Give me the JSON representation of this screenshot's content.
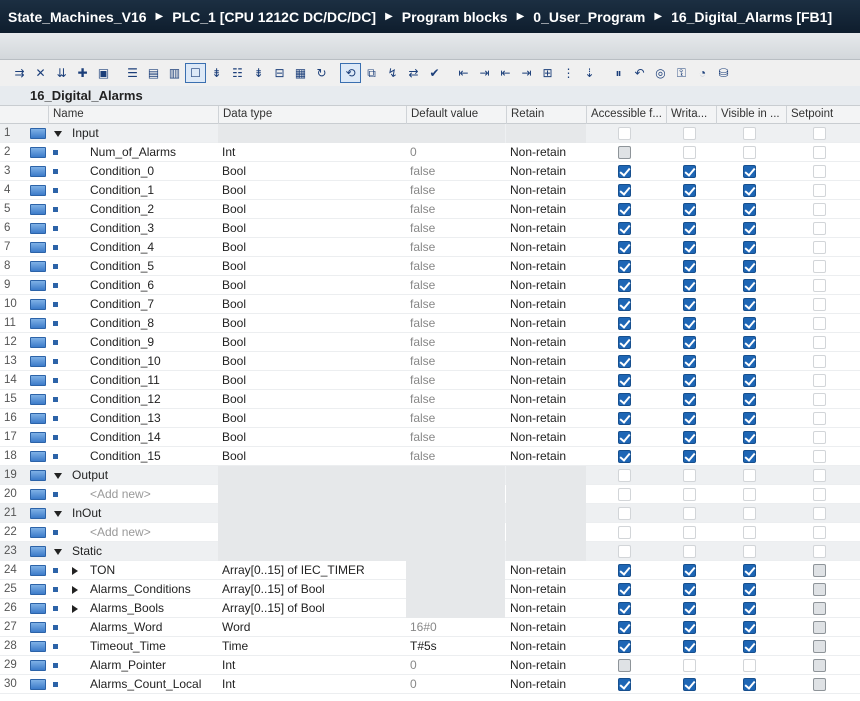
{
  "breadcrumb": [
    "State_Machines_V16",
    "PLC_1 [CPU 1212C DC/DC/DC]",
    "Program blocks",
    "0_User_Program",
    "16_Digital_Alarms [FB1]"
  ],
  "block_title": "16_Digital_Alarms",
  "columns": {
    "name": "Name",
    "data_type": "Data type",
    "default_value": "Default value",
    "retain": "Retain",
    "accessible": "Accessible f...",
    "writable": "Writa...",
    "visible": "Visible in ...",
    "setpoint": "Setpoint"
  },
  "toolbar_icons": [
    "insert-row-icon",
    "delete-row-icon",
    "insert-row-below-icon",
    "add-row-icon",
    "snapshot-icon",
    "expand-all-icon",
    "collapse-all-icon",
    "details-icon",
    "comment-icon",
    "monitor-icon",
    "load-start-icon",
    "update-icon",
    "list-icon",
    "display-icon",
    "settings-icon",
    "reset-icon",
    "copy-icon",
    "snapshot-load-icon",
    "compare-icon",
    "download-icon",
    "nav-left-icon",
    "nav-right-icon",
    "indent-icon",
    "outdent-icon",
    "grid-icon",
    "format-icon",
    "sort-icon",
    "pause-icon",
    "undo-icon",
    "watch-icon",
    "key-icon",
    "glasses-icon",
    "database-icon"
  ],
  "rows": [
    {
      "num": "1",
      "kind": "section",
      "expand": "down",
      "name": "Input",
      "type": "",
      "def": "",
      "ret": "",
      "acc": "dim",
      "wr": "dim",
      "vis": "dim",
      "set": "dim"
    },
    {
      "num": "2",
      "kind": "var",
      "name": "Num_of_Alarms",
      "type": "Int",
      "def": "0",
      "ret": "Non-retain",
      "acc": "gray",
      "wr": "dim",
      "vis": "dim",
      "set": "dim"
    },
    {
      "num": "3",
      "kind": "var",
      "name": "Condition_0",
      "type": "Bool",
      "def": "false",
      "ret": "Non-retain",
      "acc": "on",
      "wr": "on",
      "vis": "on",
      "set": "dim"
    },
    {
      "num": "4",
      "kind": "var",
      "name": "Condition_1",
      "type": "Bool",
      "def": "false",
      "ret": "Non-retain",
      "acc": "on",
      "wr": "on",
      "vis": "on",
      "set": "dim"
    },
    {
      "num": "5",
      "kind": "var",
      "name": "Condition_2",
      "type": "Bool",
      "def": "false",
      "ret": "Non-retain",
      "acc": "on",
      "wr": "on",
      "vis": "on",
      "set": "dim"
    },
    {
      "num": "6",
      "kind": "var",
      "name": "Condition_3",
      "type": "Bool",
      "def": "false",
      "ret": "Non-retain",
      "acc": "on",
      "wr": "on",
      "vis": "on",
      "set": "dim"
    },
    {
      "num": "7",
      "kind": "var",
      "name": "Condition_4",
      "type": "Bool",
      "def": "false",
      "ret": "Non-retain",
      "acc": "on",
      "wr": "on",
      "vis": "on",
      "set": "dim"
    },
    {
      "num": "8",
      "kind": "var",
      "name": "Condition_5",
      "type": "Bool",
      "def": "false",
      "ret": "Non-retain",
      "acc": "on",
      "wr": "on",
      "vis": "on",
      "set": "dim"
    },
    {
      "num": "9",
      "kind": "var",
      "name": "Condition_6",
      "type": "Bool",
      "def": "false",
      "ret": "Non-retain",
      "acc": "on",
      "wr": "on",
      "vis": "on",
      "set": "dim"
    },
    {
      "num": "10",
      "kind": "var",
      "name": "Condition_7",
      "type": "Bool",
      "def": "false",
      "ret": "Non-retain",
      "acc": "on",
      "wr": "on",
      "vis": "on",
      "set": "dim"
    },
    {
      "num": "11",
      "kind": "var",
      "name": "Condition_8",
      "type": "Bool",
      "def": "false",
      "ret": "Non-retain",
      "acc": "on",
      "wr": "on",
      "vis": "on",
      "set": "dim"
    },
    {
      "num": "12",
      "kind": "var",
      "name": "Condition_9",
      "type": "Bool",
      "def": "false",
      "ret": "Non-retain",
      "acc": "on",
      "wr": "on",
      "vis": "on",
      "set": "dim"
    },
    {
      "num": "13",
      "kind": "var",
      "name": "Condition_10",
      "type": "Bool",
      "def": "false",
      "ret": "Non-retain",
      "acc": "on",
      "wr": "on",
      "vis": "on",
      "set": "dim"
    },
    {
      "num": "14",
      "kind": "var",
      "name": "Condition_11",
      "type": "Bool",
      "def": "false",
      "ret": "Non-retain",
      "acc": "on",
      "wr": "on",
      "vis": "on",
      "set": "dim"
    },
    {
      "num": "15",
      "kind": "var",
      "name": "Condition_12",
      "type": "Bool",
      "def": "false",
      "ret": "Non-retain",
      "acc": "on",
      "wr": "on",
      "vis": "on",
      "set": "dim"
    },
    {
      "num": "16",
      "kind": "var",
      "name": "Condition_13",
      "type": "Bool",
      "def": "false",
      "ret": "Non-retain",
      "acc": "on",
      "wr": "on",
      "vis": "on",
      "set": "dim"
    },
    {
      "num": "17",
      "kind": "var",
      "name": "Condition_14",
      "type": "Bool",
      "def": "false",
      "ret": "Non-retain",
      "acc": "on",
      "wr": "on",
      "vis": "on",
      "set": "dim"
    },
    {
      "num": "18",
      "kind": "var",
      "name": "Condition_15",
      "type": "Bool",
      "def": "false",
      "ret": "Non-retain",
      "acc": "on",
      "wr": "on",
      "vis": "on",
      "set": "dim"
    },
    {
      "num": "19",
      "kind": "section",
      "expand": "down",
      "name": "Output",
      "type": "",
      "def": "",
      "ret": "",
      "acc": "dim",
      "wr": "dim",
      "vis": "dim",
      "set": "dim"
    },
    {
      "num": "20",
      "kind": "add",
      "name": "<Add new>",
      "type": "",
      "def": "",
      "ret": "",
      "acc": "dim",
      "wr": "dim",
      "vis": "dim",
      "set": "dim"
    },
    {
      "num": "21",
      "kind": "section",
      "expand": "down",
      "name": "InOut",
      "type": "",
      "def": "",
      "ret": "",
      "acc": "dim",
      "wr": "dim",
      "vis": "dim",
      "set": "dim"
    },
    {
      "num": "22",
      "kind": "add",
      "name": "<Add new>",
      "type": "",
      "def": "",
      "ret": "",
      "acc": "dim",
      "wr": "dim",
      "vis": "dim",
      "set": "dim"
    },
    {
      "num": "23",
      "kind": "section",
      "expand": "down",
      "name": "Static",
      "type": "",
      "def": "",
      "ret": "",
      "acc": "dim",
      "wr": "dim",
      "vis": "dim",
      "set": "dim"
    },
    {
      "num": "24",
      "kind": "struct",
      "expand": "right",
      "name": "TON",
      "type": "Array[0..15] of IEC_TIMER",
      "def": "",
      "ret": "Non-retain",
      "acc": "on",
      "wr": "on",
      "vis": "on",
      "set": "gray"
    },
    {
      "num": "25",
      "kind": "struct",
      "expand": "right",
      "name": "Alarms_Conditions",
      "type": "Array[0..15] of Bool",
      "def": "",
      "ret": "Non-retain",
      "acc": "on",
      "wr": "on",
      "vis": "on",
      "set": "gray"
    },
    {
      "num": "26",
      "kind": "struct",
      "expand": "right",
      "name": "Alarms_Bools",
      "type": "Array[0..15] of Bool",
      "def": "",
      "ret": "Non-retain",
      "acc": "on",
      "wr": "on",
      "vis": "on",
      "set": "gray"
    },
    {
      "num": "27",
      "kind": "var",
      "name": "Alarms_Word",
      "type": "Word",
      "def": "16#0",
      "ret": "Non-retain",
      "acc": "on",
      "wr": "on",
      "vis": "on",
      "set": "gray"
    },
    {
      "num": "28",
      "kind": "var",
      "name": "Timeout_Time",
      "type": "Time",
      "def": "T#5s",
      "ret": "Non-retain",
      "acc": "on",
      "wr": "on",
      "vis": "on",
      "set": "gray",
      "dark_def": true
    },
    {
      "num": "29",
      "kind": "var",
      "name": "Alarm_Pointer",
      "type": "Int",
      "def": "0",
      "ret": "Non-retain",
      "acc": "gray",
      "wr": "dim",
      "vis": "dim",
      "set": "gray"
    },
    {
      "num": "30",
      "kind": "var",
      "name": "Alarms_Count_Local",
      "type": "Int",
      "def": "0",
      "ret": "Non-retain",
      "acc": "on",
      "wr": "on",
      "vis": "on",
      "set": "gray"
    }
  ]
}
